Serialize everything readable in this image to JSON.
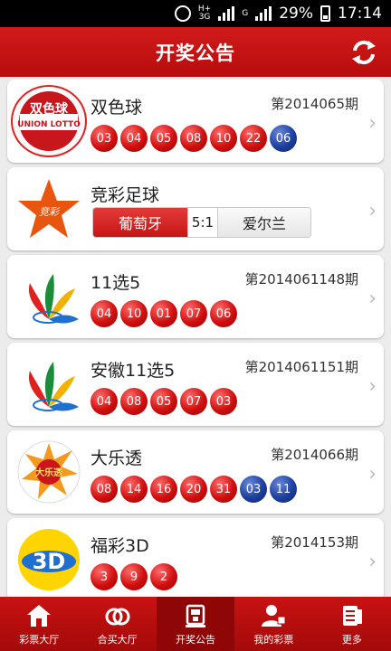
{
  "status": {
    "net1": "H+",
    "net2": "3G",
    "net3": "G",
    "battery": "29%",
    "time": "17:14"
  },
  "header": {
    "title": "开奖公告"
  },
  "lotteries": [
    {
      "name": "双色球",
      "issue": "第2014065期",
      "balls": [
        {
          "n": "03",
          "c": "red"
        },
        {
          "n": "04",
          "c": "red"
        },
        {
          "n": "05",
          "c": "red"
        },
        {
          "n": "08",
          "c": "red"
        },
        {
          "n": "10",
          "c": "red"
        },
        {
          "n": "22",
          "c": "red"
        },
        {
          "n": "06",
          "c": "blue"
        }
      ]
    },
    {
      "name": "竞彩足球",
      "team1": "葡萄牙",
      "score": "5:1",
      "team2": "爱尔兰"
    },
    {
      "name": "11选5",
      "issue": "第2014061148期",
      "balls": [
        {
          "n": "04",
          "c": "red"
        },
        {
          "n": "10",
          "c": "red"
        },
        {
          "n": "01",
          "c": "red"
        },
        {
          "n": "07",
          "c": "red"
        },
        {
          "n": "06",
          "c": "red"
        }
      ]
    },
    {
      "name": "安徽11选5",
      "issue": "第2014061151期",
      "balls": [
        {
          "n": "04",
          "c": "red"
        },
        {
          "n": "08",
          "c": "red"
        },
        {
          "n": "05",
          "c": "red"
        },
        {
          "n": "07",
          "c": "red"
        },
        {
          "n": "03",
          "c": "red"
        }
      ]
    },
    {
      "name": "大乐透",
      "issue": "第2014066期",
      "balls": [
        {
          "n": "08",
          "c": "red"
        },
        {
          "n": "14",
          "c": "red"
        },
        {
          "n": "16",
          "c": "red"
        },
        {
          "n": "20",
          "c": "red"
        },
        {
          "n": "31",
          "c": "red"
        },
        {
          "n": "03",
          "c": "blue"
        },
        {
          "n": "11",
          "c": "blue"
        }
      ]
    },
    {
      "name": "福彩3D",
      "issue": "第2014153期",
      "balls": [
        {
          "n": "3",
          "c": "red"
        },
        {
          "n": "9",
          "c": "red"
        },
        {
          "n": "2",
          "c": "red"
        }
      ]
    }
  ],
  "logos": {
    "ssq_text": "双色球",
    "ssq_sub": "UNION LOTTO",
    "jc_text": "竞彩",
    "dlt_text": "大乐透",
    "fc3d_text": "3D"
  },
  "nav": [
    {
      "label": "彩票大厅",
      "icon": "home-icon"
    },
    {
      "label": "合买大厅",
      "icon": "rings-icon"
    },
    {
      "label": "开奖公告",
      "icon": "trophy-icon"
    },
    {
      "label": "我的彩票",
      "icon": "user-icon"
    },
    {
      "label": "更多",
      "icon": "more-icon"
    }
  ],
  "colors": {
    "brand_red": "#c81212",
    "ball_red": "#d00f0f",
    "ball_blue": "#1c3f9e"
  }
}
